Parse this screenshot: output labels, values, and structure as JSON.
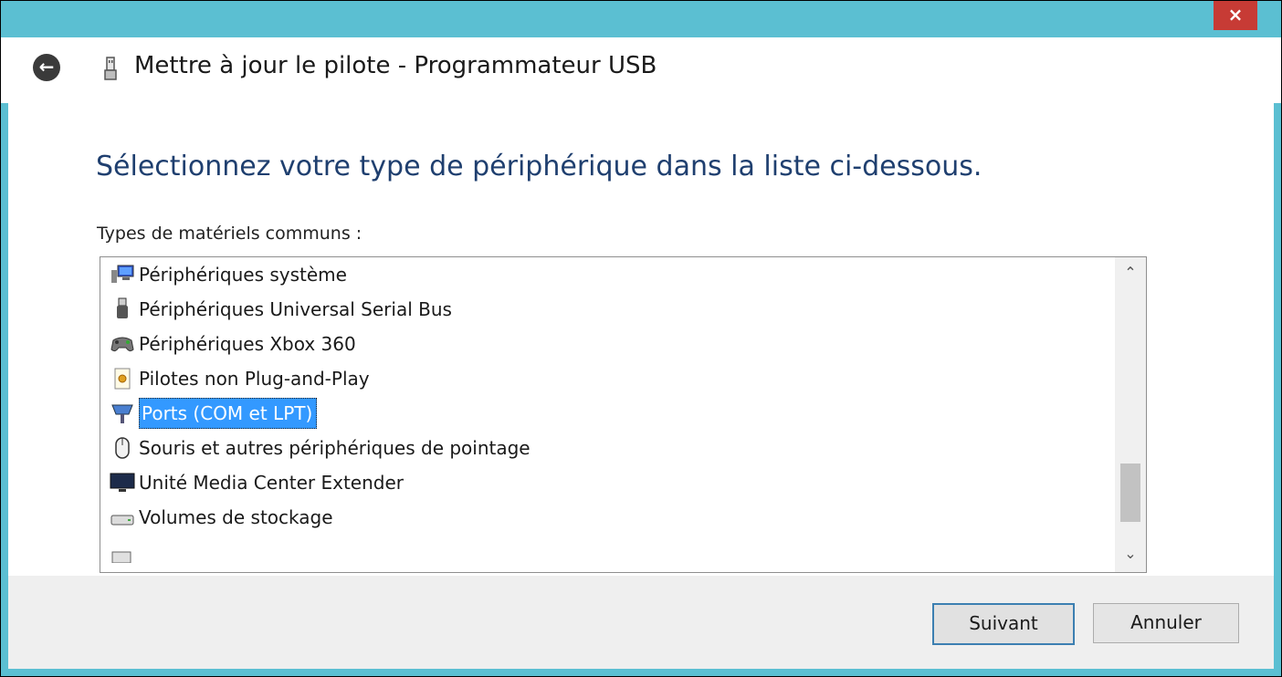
{
  "window": {
    "close_label": "×",
    "title": "Mettre à jour le pilote - Programmateur USB",
    "back_glyph": "⮌"
  },
  "main": {
    "heading": "Sélectionnez votre type de périphérique dans la liste ci-dessous.",
    "list_label": "Types de matériels communs :",
    "items": [
      {
        "label": "Périphériques système",
        "icon": "system-devices-icon",
        "selected": false
      },
      {
        "label": "Périphériques Universal Serial Bus",
        "icon": "usb-plug-icon",
        "selected": false
      },
      {
        "label": "Périphériques Xbox 360",
        "icon": "gamepad-icon",
        "selected": false
      },
      {
        "label": "Pilotes non Plug-and-Play",
        "icon": "gear-document-icon",
        "selected": false
      },
      {
        "label": "Ports (COM et LPT)",
        "icon": "port-icon",
        "selected": true
      },
      {
        "label": "Souris et autres périphériques de pointage",
        "icon": "mouse-icon",
        "selected": false
      },
      {
        "label": "Unité Media Center Extender",
        "icon": "monitor-icon",
        "selected": false
      },
      {
        "label": "Volumes de stockage",
        "icon": "drive-icon",
        "selected": false
      }
    ],
    "scroll_up": "⌃",
    "scroll_down": "⌄"
  },
  "footer": {
    "next_label": "Suivant",
    "cancel_label": "Annuler"
  },
  "colors": {
    "frame": "#5bbfd2",
    "close": "#c73b35",
    "selection": "#3399ff",
    "heading": "#1f3f6f"
  }
}
